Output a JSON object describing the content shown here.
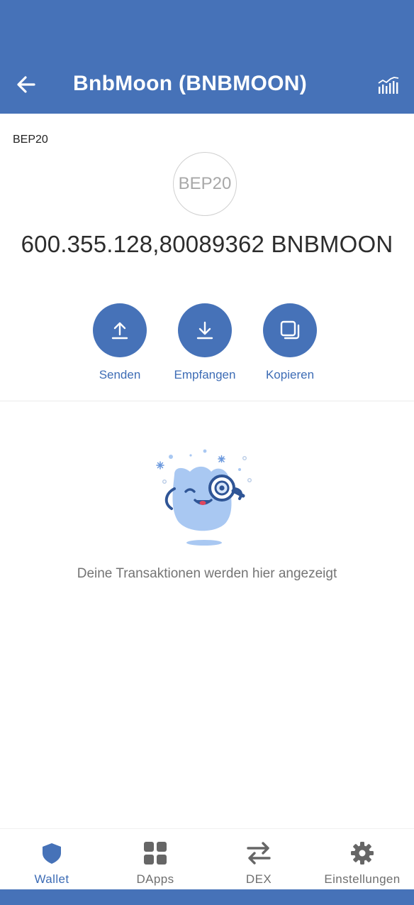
{
  "header": {
    "title": "BnbMoon (BNBMOON)",
    "back_icon": "arrow-left-icon",
    "chart_icon": "bar-chart-icon"
  },
  "token": {
    "network_tag": "BEP20",
    "logo_text": "BEP20",
    "balance": "600.355.128,80089362 BNBMOON"
  },
  "actions": [
    {
      "label": "Senden",
      "icon": "upload-icon"
    },
    {
      "label": "Empfangen",
      "icon": "download-icon"
    },
    {
      "label": "Kopieren",
      "icon": "copy-icon"
    }
  ],
  "empty_state": {
    "message": "Deine Transaktionen werden hier angezeigt",
    "illustration": "magnifier-mascot-illustration"
  },
  "bottom_nav": {
    "active": "Wallet",
    "items": [
      {
        "label": "Wallet",
        "icon": "shield-icon"
      },
      {
        "label": "DApps",
        "icon": "grid-icon"
      },
      {
        "label": "DEX",
        "icon": "swap-arrows-icon"
      },
      {
        "label": "Einstellungen",
        "icon": "gear-icon"
      }
    ]
  },
  "colors": {
    "brand": "#4672b8",
    "accent_text": "#3d6cb5",
    "inactive_nav": "#6f6f6f"
  }
}
